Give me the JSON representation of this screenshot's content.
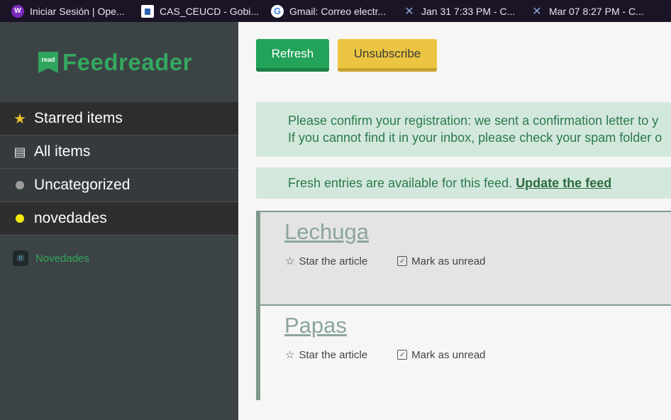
{
  "bookmarks": [
    {
      "icon": "wasp-icon",
      "label": "Iniciar Sesión | Ope..."
    },
    {
      "icon": "document-icon",
      "label": "CAS_CEUCD - Gobi..."
    },
    {
      "icon": "google-icon",
      "label": "Gmail: Correo electr..."
    },
    {
      "icon": "x-icon",
      "label": "Jan 31 7:33 PM - C..."
    },
    {
      "icon": "x-icon",
      "label": "Mar 07 8:27 PM - C..."
    }
  ],
  "logo": {
    "badge": "read",
    "text": "Feedreader"
  },
  "nav": {
    "starred": "Starred items",
    "all": "All items",
    "uncategorized": "Uncategorized",
    "novedades": "novedades"
  },
  "feed": {
    "label": "Novedades"
  },
  "toolbar": {
    "refresh": "Refresh",
    "unsubscribe": "Unsubscribe"
  },
  "notices": {
    "confirm_line1": "Please confirm your registration: we sent a confirmation letter to y",
    "confirm_line2": "If you cannot find it in your inbox, please check your spam folder o",
    "fresh_text": "Fresh entries are available for this feed.",
    "fresh_link": "Update the feed"
  },
  "articles": [
    {
      "title": "Lechuga",
      "star": "Star the article",
      "unread": "Mark as unread"
    },
    {
      "title": "Papas",
      "star": "Star the article",
      "unread": "Mark as unread"
    }
  ],
  "colors": {
    "sidebar_bg": "#3c4345",
    "brand_green": "#33a85f",
    "refresh": "#22a35a",
    "unsubscribe": "#ebc541",
    "notice_bg": "#d3e8dc"
  }
}
